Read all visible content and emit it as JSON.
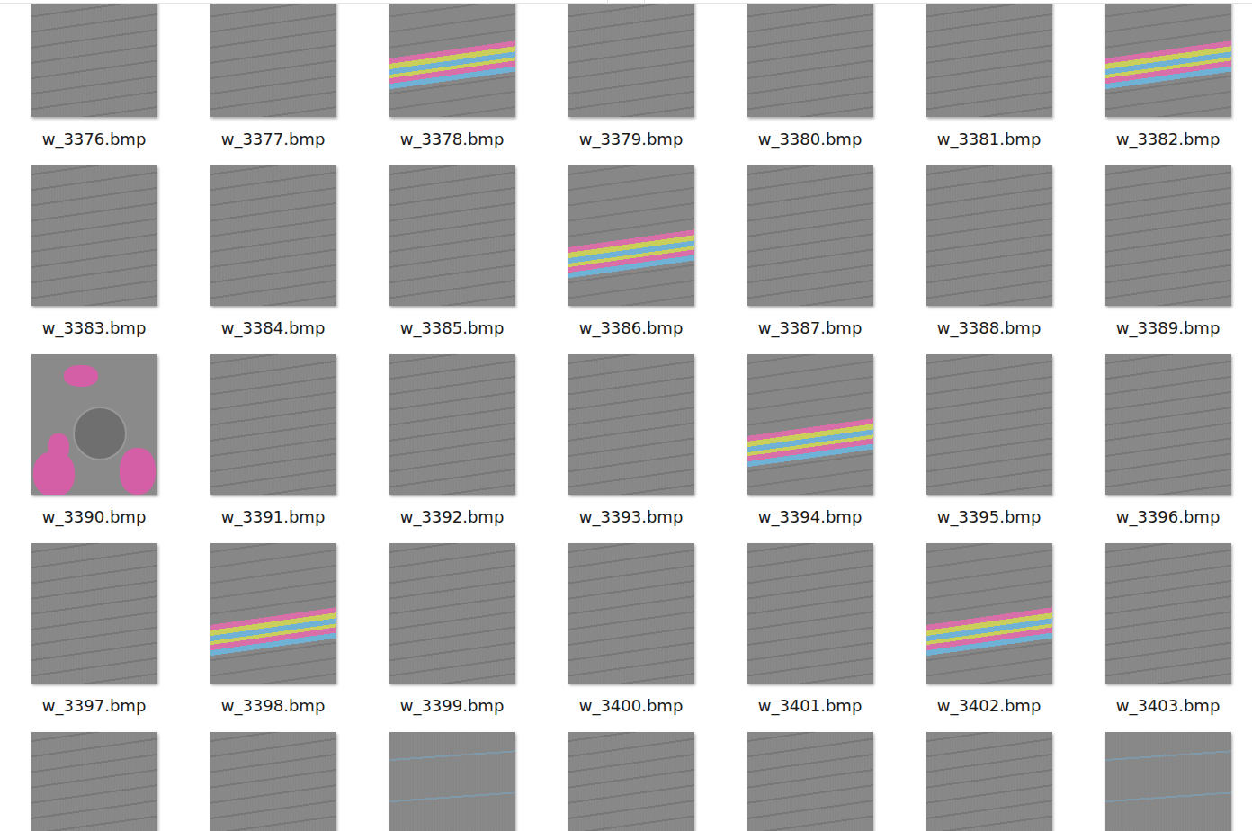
{
  "files": [
    {
      "label": "w_3376.bmp",
      "kind": "gray"
    },
    {
      "label": "w_3377.bmp",
      "kind": "gray"
    },
    {
      "label": "w_3378.bmp",
      "kind": "stripes"
    },
    {
      "label": "w_3379.bmp",
      "kind": "gray"
    },
    {
      "label": "w_3380.bmp",
      "kind": "gray"
    },
    {
      "label": "w_3381.bmp",
      "kind": "gray"
    },
    {
      "label": "w_3382.bmp",
      "kind": "stripes"
    },
    {
      "label": "w_3383.bmp",
      "kind": "gray"
    },
    {
      "label": "w_3384.bmp",
      "kind": "gray"
    },
    {
      "label": "w_3385.bmp",
      "kind": "gray"
    },
    {
      "label": "w_3386.bmp",
      "kind": "stripes"
    },
    {
      "label": "w_3387.bmp",
      "kind": "gray"
    },
    {
      "label": "w_3388.bmp",
      "kind": "gray"
    },
    {
      "label": "w_3389.bmp",
      "kind": "gray"
    },
    {
      "label": "w_3390.bmp",
      "kind": "badge"
    },
    {
      "label": "w_3391.bmp",
      "kind": "gray"
    },
    {
      "label": "w_3392.bmp",
      "kind": "gray"
    },
    {
      "label": "w_3393.bmp",
      "kind": "gray"
    },
    {
      "label": "w_3394.bmp",
      "kind": "stripes"
    },
    {
      "label": "w_3395.bmp",
      "kind": "gray"
    },
    {
      "label": "w_3396.bmp",
      "kind": "gray"
    },
    {
      "label": "w_3397.bmp",
      "kind": "gray"
    },
    {
      "label": "w_3398.bmp",
      "kind": "stripes"
    },
    {
      "label": "w_3399.bmp",
      "kind": "gray"
    },
    {
      "label": "w_3400.bmp",
      "kind": "gray"
    },
    {
      "label": "w_3401.bmp",
      "kind": "gray"
    },
    {
      "label": "w_3402.bmp",
      "kind": "stripes"
    },
    {
      "label": "w_3403.bmp",
      "kind": "gray"
    },
    {
      "kind": "gray"
    },
    {
      "kind": "gray"
    },
    {
      "kind": "faint"
    },
    {
      "kind": "gray"
    },
    {
      "kind": "gray"
    },
    {
      "kind": "gray"
    },
    {
      "kind": "faint"
    }
  ]
}
